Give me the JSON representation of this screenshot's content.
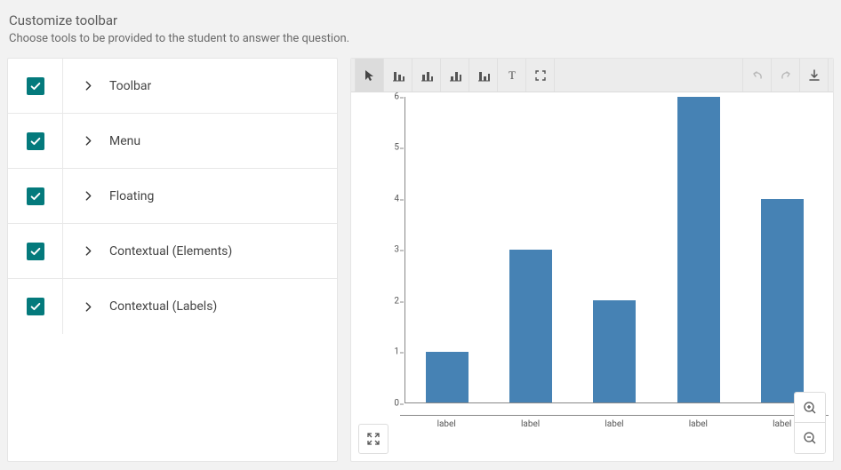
{
  "title": "Customize toolbar",
  "subtitle": "Choose tools to be provided to the student to answer the question.",
  "rows": {
    "0": {
      "label": "Toolbar",
      "checked": true
    },
    "1": {
      "label": "Menu",
      "checked": true
    },
    "2": {
      "label": "Floating",
      "checked": true
    },
    "3": {
      "label": "Contextual (Elements)",
      "checked": true
    },
    "4": {
      "label": "Contextual (Labels)",
      "checked": true
    }
  },
  "toolbar_icons": {
    "pointer": "pointer",
    "bar_tool_1": "bar-preset-1",
    "bar_tool_2": "bar-preset-2",
    "bar_tool_3": "bar-preset-3",
    "bar_tool_4": "bar-preset-4",
    "text": "T",
    "fullscreen": "fullscreen",
    "undo": "undo",
    "redo": "redo",
    "download": "download"
  },
  "chart_data": {
    "type": "bar",
    "categories": [
      "label",
      "label",
      "label",
      "label",
      "label"
    ],
    "values": [
      1,
      3,
      2,
      6,
      4
    ],
    "ylim": [
      0,
      6
    ],
    "yticks": [
      0,
      1,
      2,
      3,
      4,
      5,
      6
    ],
    "bar_color": "#4682b4"
  },
  "float": {
    "expand": "expand",
    "zoom_in": "zoom-in",
    "zoom_out": "zoom-out"
  }
}
